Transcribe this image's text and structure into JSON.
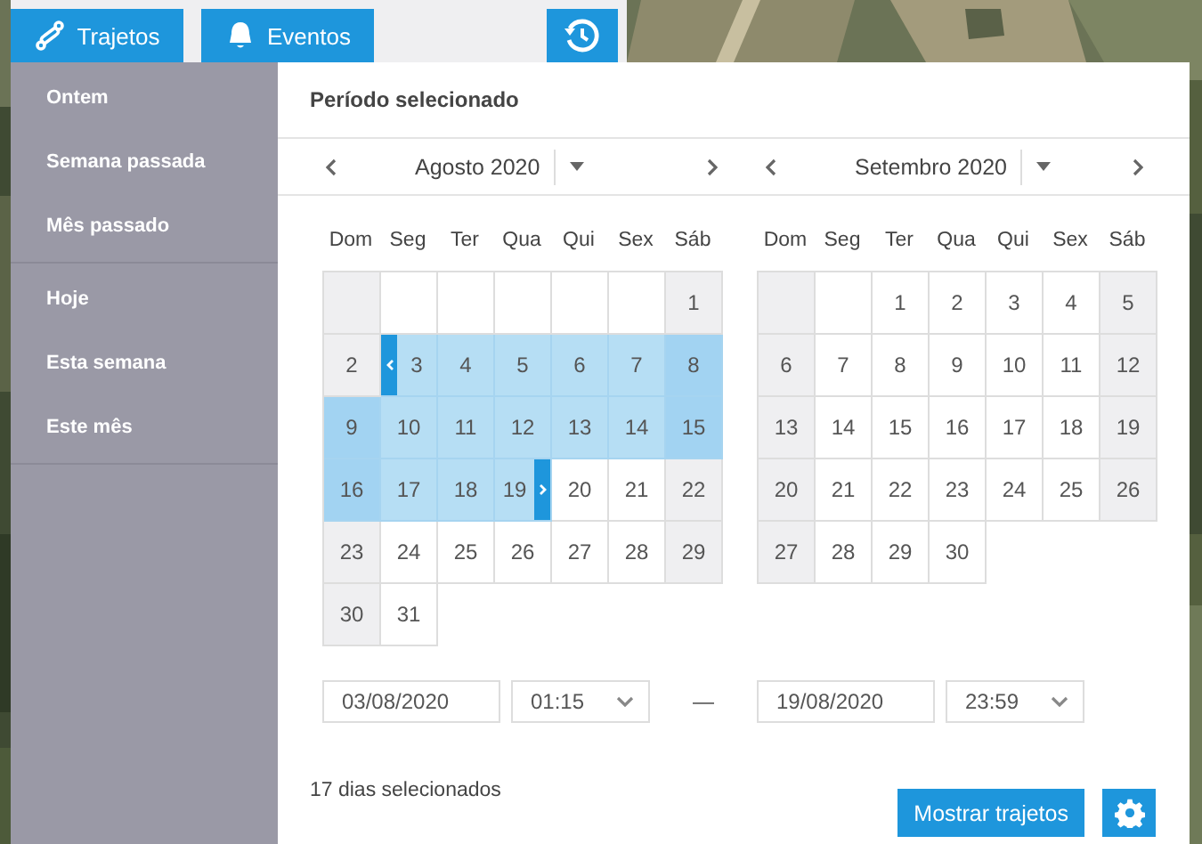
{
  "top_bar": {
    "tabs": [
      {
        "label": "Trajetos",
        "kind": "route"
      },
      {
        "label": "Eventos",
        "kind": "bell"
      }
    ]
  },
  "sidebar": {
    "groups": [
      {
        "items": [
          "Ontem",
          "Semana passada",
          "Mês passado"
        ]
      },
      {
        "items": [
          "Hoje",
          "Esta semana",
          "Este mês"
        ]
      }
    ]
  },
  "panel": {
    "title": "Período selecionado",
    "months": [
      {
        "title": "Agosto 2020",
        "weekdays": [
          "Dom",
          "Seg",
          "Ter",
          "Qua",
          "Qui",
          "Sex",
          "Sáb"
        ],
        "weeks": [
          [
            {
              "kind": "blank"
            },
            {
              "kind": "blank"
            },
            {
              "kind": "blank"
            },
            {
              "kind": "blank"
            },
            {
              "kind": "blank"
            },
            {
              "kind": "blank"
            },
            {
              "kind": "day",
              "day": "1",
              "in_range": false
            }
          ],
          [
            {
              "kind": "day",
              "day": "2",
              "in_range": false
            },
            {
              "kind": "day",
              "day": "3",
              "in_range": true,
              "range_start": true
            },
            {
              "kind": "day",
              "day": "4",
              "in_range": true
            },
            {
              "kind": "day",
              "day": "5",
              "in_range": true
            },
            {
              "kind": "day",
              "day": "6",
              "in_range": true
            },
            {
              "kind": "day",
              "day": "7",
              "in_range": true
            },
            {
              "kind": "day",
              "day": "8",
              "in_range": true
            }
          ],
          [
            {
              "kind": "day",
              "day": "9",
              "in_range": true
            },
            {
              "kind": "day",
              "day": "10",
              "in_range": true
            },
            {
              "kind": "day",
              "day": "11",
              "in_range": true
            },
            {
              "kind": "day",
              "day": "12",
              "in_range": true
            },
            {
              "kind": "day",
              "day": "13",
              "in_range": true
            },
            {
              "kind": "day",
              "day": "14",
              "in_range": true
            },
            {
              "kind": "day",
              "day": "15",
              "in_range": true
            }
          ],
          [
            {
              "kind": "day",
              "day": "16",
              "in_range": true
            },
            {
              "kind": "day",
              "day": "17",
              "in_range": true
            },
            {
              "kind": "day",
              "day": "18",
              "in_range": true
            },
            {
              "kind": "day",
              "day": "19",
              "in_range": true,
              "range_end": true
            },
            {
              "kind": "day",
              "day": "20",
              "in_range": false
            },
            {
              "kind": "day",
              "day": "21",
              "in_range": false
            },
            {
              "kind": "day",
              "day": "22",
              "in_range": false
            }
          ],
          [
            {
              "kind": "day",
              "day": "23",
              "in_range": false
            },
            {
              "kind": "day",
              "day": "24",
              "in_range": false
            },
            {
              "kind": "day",
              "day": "25",
              "in_range": false
            },
            {
              "kind": "day",
              "day": "26",
              "in_range": false
            },
            {
              "kind": "day",
              "day": "27",
              "in_range": false
            },
            {
              "kind": "day",
              "day": "28",
              "in_range": false
            },
            {
              "kind": "day",
              "day": "29",
              "in_range": false
            }
          ],
          [
            {
              "kind": "day",
              "day": "30",
              "in_range": false
            },
            {
              "kind": "day",
              "day": "31",
              "in_range": false
            }
          ]
        ]
      },
      {
        "title": "Setembro 2020",
        "weekdays": [
          "Dom",
          "Seg",
          "Ter",
          "Qua",
          "Qui",
          "Sex",
          "Sáb"
        ],
        "weeks": [
          [
            {
              "kind": "blank"
            },
            {
              "kind": "blank"
            },
            {
              "kind": "day",
              "day": "1",
              "in_range": false
            },
            {
              "kind": "day",
              "day": "2",
              "in_range": false
            },
            {
              "kind": "day",
              "day": "3",
              "in_range": false
            },
            {
              "kind": "day",
              "day": "4",
              "in_range": false
            },
            {
              "kind": "day",
              "day": "5",
              "in_range": false
            }
          ],
          [
            {
              "kind": "day",
              "day": "6",
              "in_range": false
            },
            {
              "kind": "day",
              "day": "7",
              "in_range": false
            },
            {
              "kind": "day",
              "day": "8",
              "in_range": false
            },
            {
              "kind": "day",
              "day": "9",
              "in_range": false
            },
            {
              "kind": "day",
              "day": "10",
              "in_range": false
            },
            {
              "kind": "day",
              "day": "11",
              "in_range": false
            },
            {
              "kind": "day",
              "day": "12",
              "in_range": false
            }
          ],
          [
            {
              "kind": "day",
              "day": "13",
              "in_range": false
            },
            {
              "kind": "day",
              "day": "14",
              "in_range": false
            },
            {
              "kind": "day",
              "day": "15",
              "in_range": false
            },
            {
              "kind": "day",
              "day": "16",
              "in_range": false
            },
            {
              "kind": "day",
              "day": "17",
              "in_range": false
            },
            {
              "kind": "day",
              "day": "18",
              "in_range": false
            },
            {
              "kind": "day",
              "day": "19",
              "in_range": false
            }
          ],
          [
            {
              "kind": "day",
              "day": "20",
              "in_range": false
            },
            {
              "kind": "day",
              "day": "21",
              "in_range": false
            },
            {
              "kind": "day",
              "day": "22",
              "in_range": false
            },
            {
              "kind": "day",
              "day": "23",
              "in_range": false
            },
            {
              "kind": "day",
              "day": "24",
              "in_range": false
            },
            {
              "kind": "day",
              "day": "25",
              "in_range": false
            },
            {
              "kind": "day",
              "day": "26",
              "in_range": false
            }
          ],
          [
            {
              "kind": "day",
              "day": "27",
              "in_range": false
            },
            {
              "kind": "day",
              "day": "28",
              "in_range": false
            },
            {
              "kind": "day",
              "day": "29",
              "in_range": false
            },
            {
              "kind": "day",
              "day": "30",
              "in_range": false
            }
          ]
        ]
      }
    ],
    "start_date": "03/08/2020",
    "start_time": "01:15",
    "range_separator": "—",
    "end_date": "19/08/2020",
    "end_time": "23:59",
    "summary": "17 dias selecionados",
    "submit_button": "Mostrar trajetos"
  }
}
